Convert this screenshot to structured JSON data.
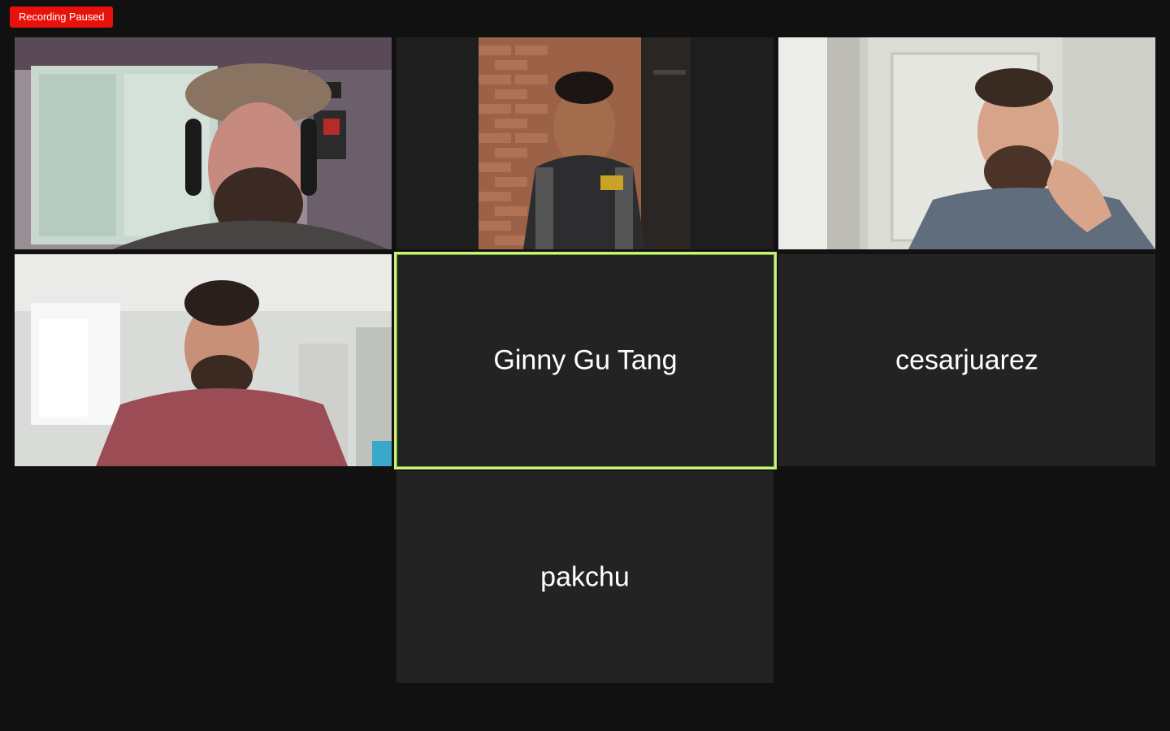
{
  "recording": {
    "status_label": "Recording Paused",
    "color": "#e8110b"
  },
  "gallery": {
    "participants": [
      {
        "name": "",
        "video_on": true,
        "row": 1,
        "col": 1
      },
      {
        "name": "",
        "video_on": true,
        "row": 1,
        "col": 2
      },
      {
        "name": "",
        "video_on": true,
        "row": 1,
        "col": 3
      },
      {
        "name": "",
        "video_on": true,
        "row": 2,
        "col": 1
      },
      {
        "name": "Ginny Gu Tang",
        "video_on": false,
        "active_speaker": true,
        "row": 2,
        "col": 2
      },
      {
        "name": "cesarjuarez",
        "video_on": false,
        "row": 2,
        "col": 3
      },
      {
        "name": "pakchu",
        "video_on": false,
        "row": 3,
        "col": 2
      }
    ]
  },
  "colors": {
    "background": "#111111",
    "tile": "#232323",
    "active_speaker_border": "#d9ea7d"
  }
}
